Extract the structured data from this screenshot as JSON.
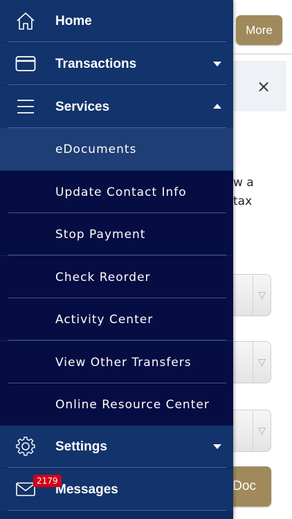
{
  "background": {
    "more_label": "More",
    "close_glyph": "×",
    "text_line_1": "w a",
    "text_line_2": "tax",
    "select_caret": "▽",
    "doc_label": "Doc"
  },
  "drawer": {
    "items": [
      {
        "label": "Home",
        "icon": "home-icon"
      },
      {
        "label": "Transactions",
        "icon": "card-icon",
        "chevron": "down"
      },
      {
        "label": "Services",
        "icon": "hamburger-icon",
        "chevron": "up"
      },
      {
        "label": "eDocuments",
        "selected": true
      },
      {
        "label": "Update Contact Info"
      },
      {
        "label": "Stop Payment"
      },
      {
        "label": "Check Reorder"
      },
      {
        "label": "Activity Center"
      },
      {
        "label": "View Other Transfers"
      },
      {
        "label": "Online Resource Center"
      },
      {
        "label": "Settings",
        "icon": "gear-icon",
        "chevron": "down"
      },
      {
        "label": "Messages",
        "icon": "envelope-icon",
        "badge": "2179"
      }
    ]
  },
  "colors": {
    "drawer_main": "#12336b",
    "drawer_sub": "#060d42",
    "drawer_selected": "#1f3e75",
    "accent_gold": "#a08a5c",
    "badge_red": "#d0021b"
  }
}
